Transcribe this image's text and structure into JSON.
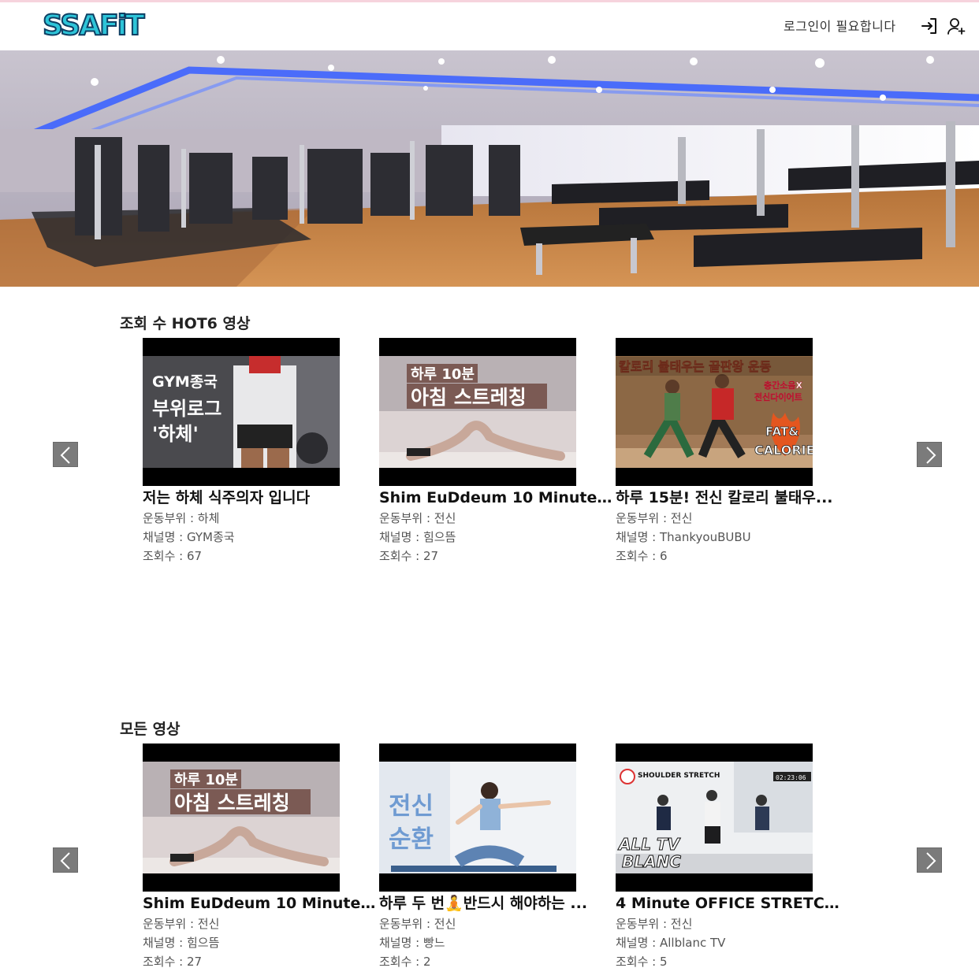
{
  "header": {
    "logo_text": "SSAFiT",
    "login_status": "로그인이 필요합니다",
    "login_icon": "login-icon",
    "signup_icon": "user-add-icon"
  },
  "banner": {
    "image": "gym-interior-photo"
  },
  "hot_section": {
    "title": "조회 수 HOT6 영상",
    "videos": [
      {
        "title": "저는 하체 식주의자 입니다",
        "part_label": "운동부위 : 하체",
        "channel_label": "채널명 : GYM종국",
        "views_label": "조회수 : 67",
        "thumb_caption": [
          "GYM종국",
          "부위로그",
          "'하체'"
        ]
      },
      {
        "title": "Shim EuDdeum 10 Minute M...",
        "part_label": "운동부위 : 전신",
        "channel_label": "채널명 : 힘으뜸",
        "views_label": "조회수 : 27",
        "thumb_caption": [
          "하루 10분",
          "아침 스트레칭"
        ]
      },
      {
        "title": "하루 15분! 전신 칼로리 불태우...",
        "part_label": "운동부위 : 전신",
        "channel_label": "채널명 : ThankyouBUBU",
        "views_label": "조회수 : 6",
        "thumb_caption": [
          "칼로리 불태우는 끝판왕 운동",
          "층간소음X",
          "전신다이어트",
          "FAT&",
          "CALORIE"
        ]
      }
    ]
  },
  "all_section": {
    "title": "모든 영상",
    "videos": [
      {
        "title": "Shim EuDdeum 10 Minute M...",
        "part_label": "운동부위 : 전신",
        "channel_label": "채널명 : 힘으뜸",
        "views_label": "조회수 : 27",
        "thumb_caption": [
          "하루 10분",
          "아침 스트레칭"
        ]
      },
      {
        "title": "하루 두 번🧘반드시 해야하는 ...",
        "part_label": "운동부위 : 전신",
        "channel_label": "채널명 : 빵느",
        "views_label": "조회수 : 2",
        "thumb_caption": [
          "전신",
          "순환"
        ]
      },
      {
        "title": "4 Minute OFFICE STRETCHIN...",
        "part_label": "운동부위 : 전신",
        "channel_label": "채널명 : Allblanc TV",
        "views_label": "조회수 : 5",
        "thumb_caption": [
          "SHOULDER STRETCH",
          "ALL TV",
          "BLANC",
          "02:23:06"
        ]
      }
    ]
  },
  "carousel": {
    "prev_icon": "chevron-left-icon",
    "next_icon": "chevron-right-icon"
  }
}
